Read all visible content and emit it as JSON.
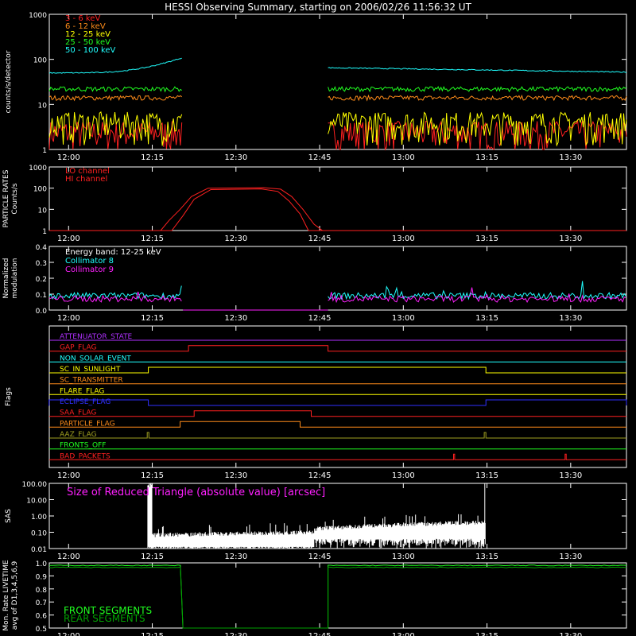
{
  "title": "HESSI Observing Summary, starting on 2006/02/26 11:56:32 UT",
  "time_ticks": [
    "12:00",
    "12:15",
    "12:30",
    "12:45",
    "13:00",
    "13:15",
    "13:30"
  ],
  "time_tick_minutes": [
    720,
    735,
    750,
    765,
    780,
    795,
    810
  ],
  "time_range_minutes": [
    716.54,
    820
  ],
  "colors": {
    "background": "#000000",
    "axes": "#ffffff",
    "red": "#ff2020",
    "orange": "#ff8c1a",
    "yellow": "#ffff00",
    "green": "#20ff20",
    "cyan": "#20ffff",
    "magenta": "#ff20ff",
    "purple": "#b030ff",
    "blue": "#3030ff",
    "olive": "#a0a020",
    "white": "#ffffff",
    "dark_green": "#00a000"
  },
  "chart_data": [
    {
      "type": "line",
      "ylabel": "counts/s/detector",
      "yscale": "log",
      "ylim": [
        1,
        1000
      ],
      "yticks": [
        "1",
        "10",
        "100",
        "1000"
      ],
      "gap_minutes": [
        740.5,
        766.5
      ],
      "series": [
        {
          "name": "3 - 6 keV",
          "color": "#ff2020",
          "before_gap": 2.5,
          "after_gap": 2.5
        },
        {
          "name": "6 - 12 keV",
          "color": "#ff8c1a",
          "before_gap": 14,
          "after_gap": 14
        },
        {
          "name": "12 - 25 keV",
          "color": "#ffff00",
          "before_gap": 4,
          "after_gap": 4
        },
        {
          "name": "25 - 50 keV",
          "color": "#20ff20",
          "before_gap": 22,
          "after_gap": 22
        },
        {
          "name": "50 - 100 keV",
          "color": "#20ffff",
          "start": 50,
          "end_before_gap": 110,
          "after_gap_start": 65,
          "after_gap_end": 52
        }
      ]
    },
    {
      "type": "line",
      "ylabel_line1": "PARTICLE RATES",
      "ylabel_line2": "Counts/s",
      "yscale": "log",
      "ylim": [
        1,
        1000
      ],
      "yticks": [
        "1",
        "10",
        "100",
        "1000"
      ],
      "series": [
        {
          "name": "LO channel",
          "color": "#ff2020",
          "profile": [
            [
              716.5,
              1
            ],
            [
              736.5,
              1
            ],
            [
              738,
              3
            ],
            [
              740,
              10
            ],
            [
              742,
              40
            ],
            [
              745,
              100
            ],
            [
              755,
              105
            ],
            [
              758,
              90
            ],
            [
              760,
              40
            ],
            [
              762,
              10
            ],
            [
              764,
              2
            ],
            [
              765.5,
              1
            ],
            [
              820,
              1
            ]
          ]
        },
        {
          "name": "HI channel",
          "color": "#ff2020",
          "profile": [
            [
              716.5,
              1
            ],
            [
              738.5,
              1
            ],
            [
              740.5,
              5
            ],
            [
              742.5,
              30
            ],
            [
              745.5,
              85
            ],
            [
              754.5,
              92
            ],
            [
              757.5,
              70
            ],
            [
              759.5,
              25
            ],
            [
              761.5,
              6
            ],
            [
              763,
              1
            ],
            [
              820,
              1
            ]
          ]
        }
      ]
    },
    {
      "type": "line",
      "ylabel_line1": "Normalized",
      "ylabel_line2": "modulation",
      "ylim": [
        0,
        0.4
      ],
      "yticks": [
        "0.0",
        "0.1",
        "0.2",
        "0.3",
        "0.4"
      ],
      "annotation": "Energy band: 12-25 keV",
      "gap_minutes": [
        740.5,
        766.5
      ],
      "series": [
        {
          "name": "Collimator 8",
          "color": "#20ffff",
          "level": 0.09
        },
        {
          "name": "Collimator 9",
          "color": "#ff20ff",
          "level": 0.07
        }
      ]
    },
    {
      "type": "flags",
      "ylabel": "Flags",
      "flags": [
        {
          "name": "ATTENUATOR_STATE",
          "color": "#b030ff",
          "on": []
        },
        {
          "name": "GAP_FLAG",
          "color": "#ff2020",
          "on": [
            [
              741.5,
              766.5
            ]
          ]
        },
        {
          "name": "NON_SOLAR_EVENT",
          "color": "#20ffff",
          "on": []
        },
        {
          "name": "SC_IN_SUNLIGHT",
          "color": "#ffff00",
          "on": [
            [
              734.3,
              794.8
            ]
          ]
        },
        {
          "name": "SC_TRANSMITTER",
          "color": "#ff8c1a",
          "on": []
        },
        {
          "name": "FLARE_FLAG",
          "color": "#ffff00",
          "on": []
        },
        {
          "name": "ECLIPSE_FLAG",
          "color": "#3030ff",
          "on": [
            [
              716.5,
              734.3
            ],
            [
              794.8,
              820
            ]
          ]
        },
        {
          "name": "SAA_FLAG",
          "color": "#ff2020",
          "on": [
            [
              742.5,
              763.5
            ]
          ]
        },
        {
          "name": "PARTICLE_FLAG",
          "color": "#ff8c1a",
          "on": [
            [
              740,
              761.5
            ]
          ]
        },
        {
          "name": "AAZ_FLAG",
          "color": "#a0a020",
          "on": [
            [
              734.1,
              734.4
            ],
            [
              794.5,
              794.8
            ]
          ]
        },
        {
          "name": "FRONTS_OFF",
          "color": "#20ff20",
          "on": []
        },
        {
          "name": "BAD_PACKETS",
          "color": "#ff2020",
          "on": [
            [
              789,
              789.2
            ],
            [
              809,
              809.2
            ]
          ]
        }
      ]
    },
    {
      "type": "line",
      "ylabel": "SAS",
      "yscale": "log",
      "ylim": [
        0.01,
        100
      ],
      "yticks": [
        "0.01",
        "0.10",
        "1.00",
        "10.00",
        "100.00"
      ],
      "annotation": "Size of Reduced Triangle (absolute value) [arcsec]",
      "series": [
        {
          "name": "SAS",
          "color": "#ffffff"
        }
      ]
    },
    {
      "type": "line",
      "ylabel_line1": "Mon. Rate LIVETIME",
      "ylabel_line2": "avg of D1,3,4,5,6,9",
      "ylim": [
        0.5,
        1.0
      ],
      "yticks": [
        "0.5",
        "0.6",
        "0.7",
        "0.8",
        "0.9",
        "1.0"
      ],
      "gap_minutes": [
        740.5,
        766.5
      ],
      "series": [
        {
          "name": "FRONT SEGMENTS",
          "color": "#20ff20",
          "level": 0.98
        },
        {
          "name": "REAR SEGMENTS",
          "color": "#00a000",
          "level": 0.965
        }
      ]
    }
  ]
}
